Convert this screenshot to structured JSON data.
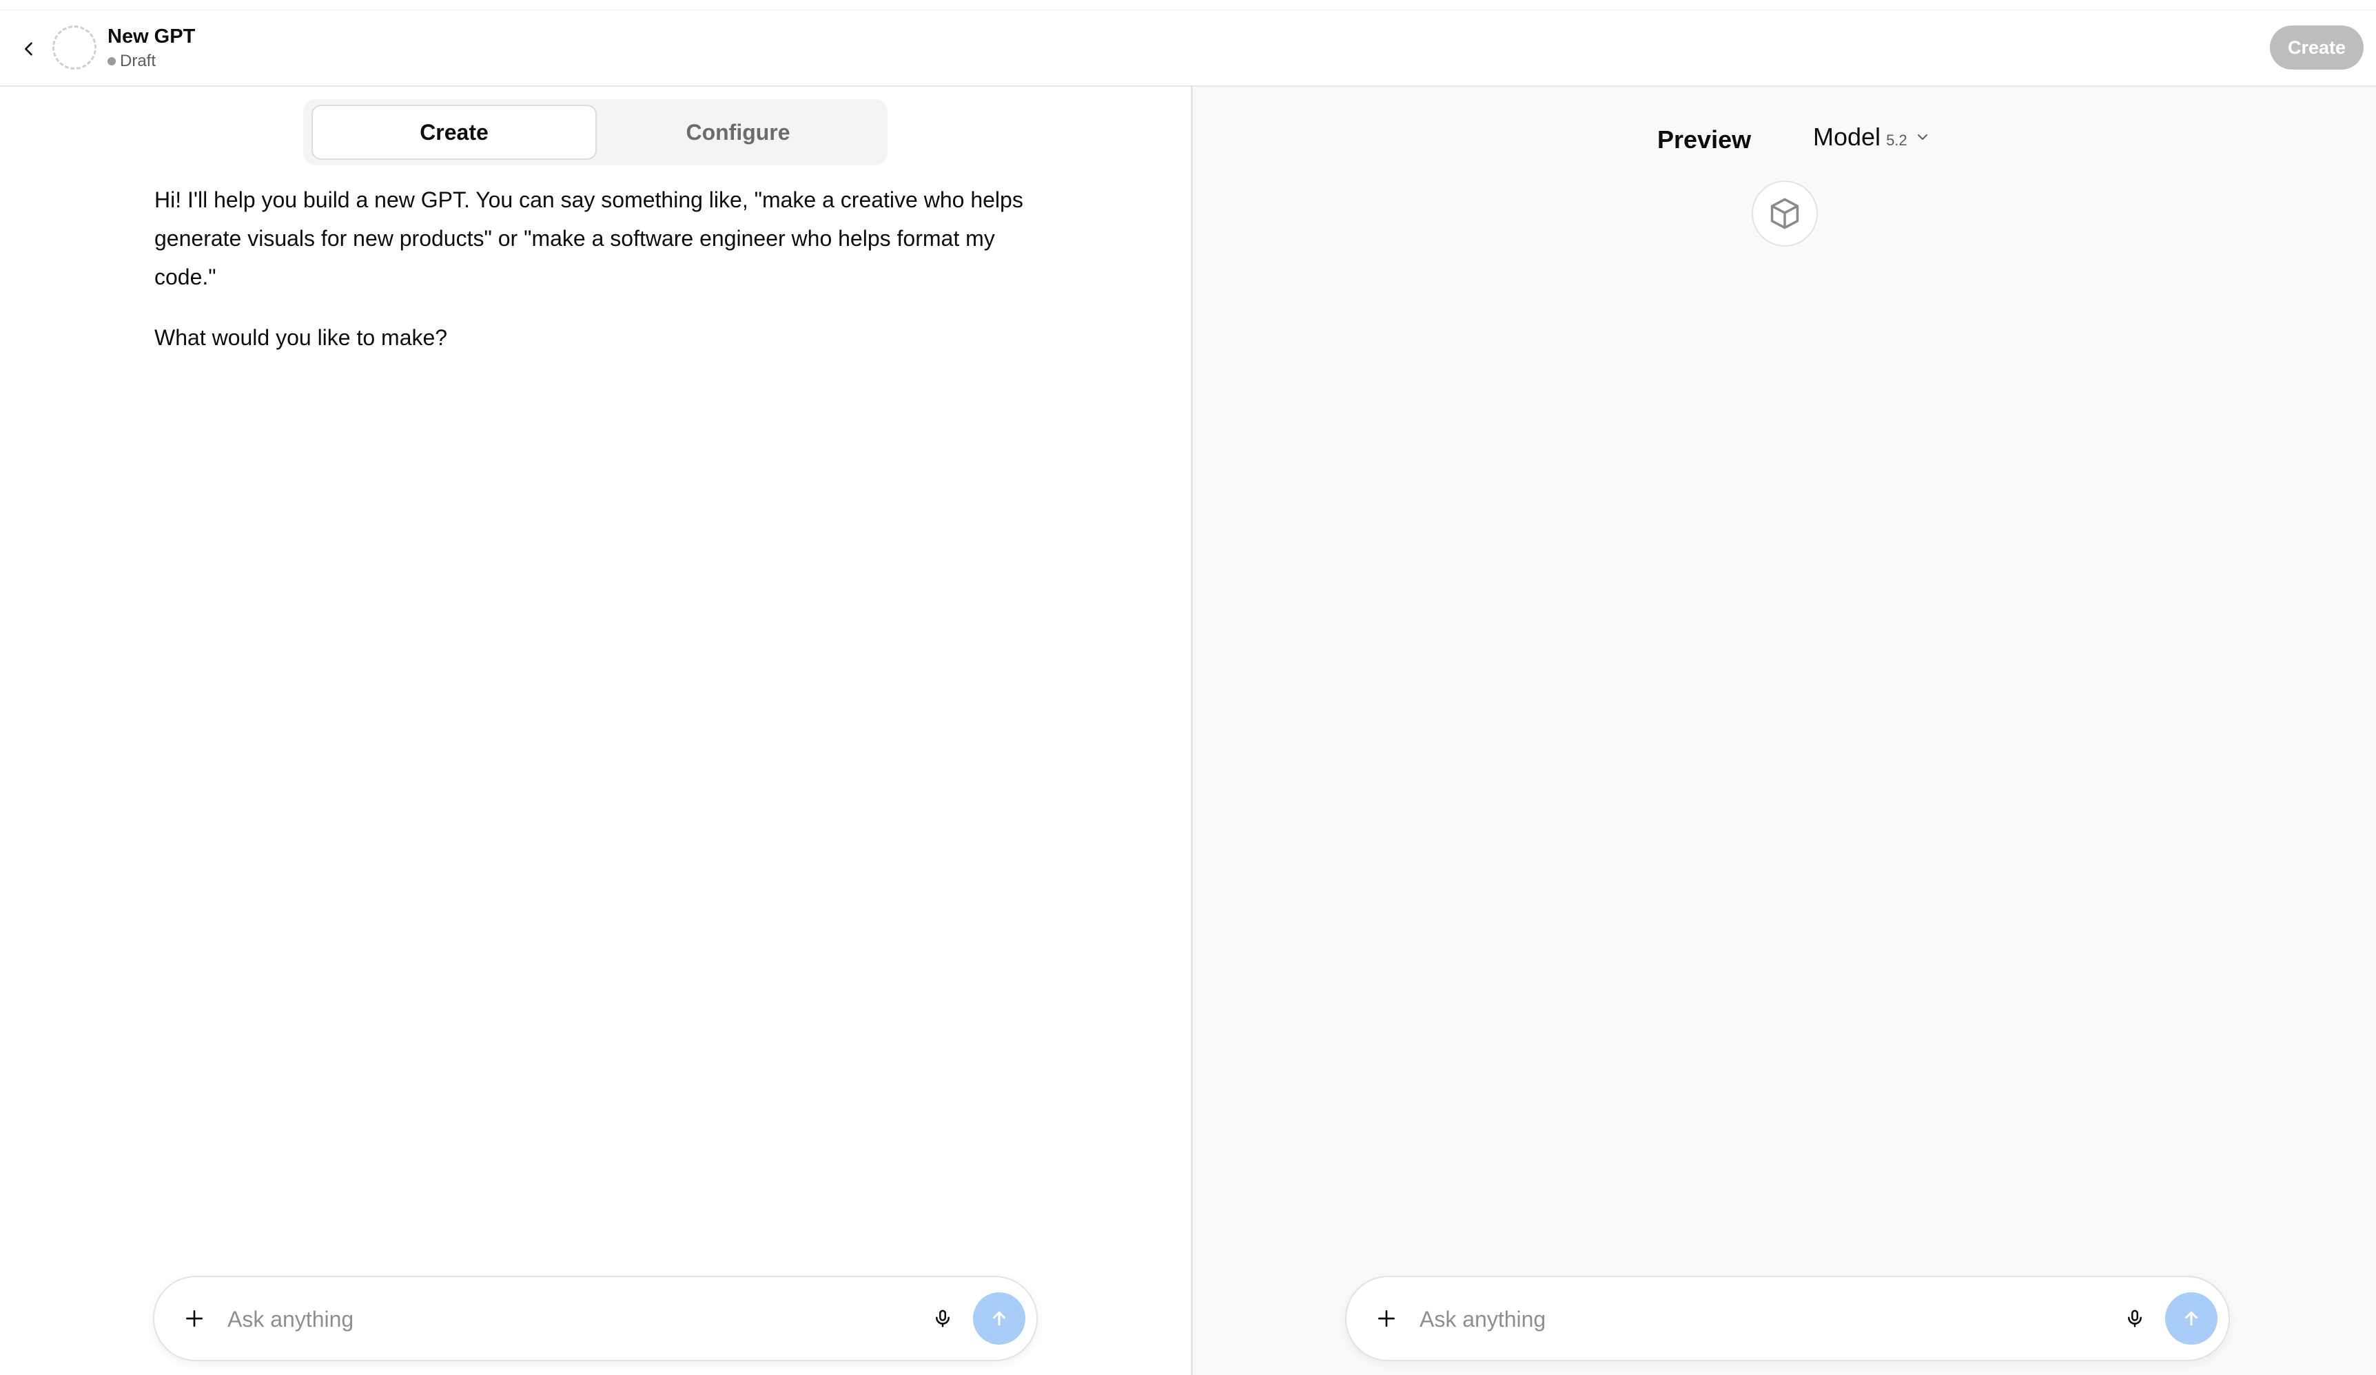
{
  "header": {
    "title": "New GPT",
    "status": "Draft",
    "create_label": "Create"
  },
  "tabs": [
    {
      "label": "Create",
      "active": true
    },
    {
      "label": "Configure",
      "active": false
    }
  ],
  "builder": {
    "messages": [
      "Hi! I'll help you build a new GPT. You can say something like, \"make a creative who helps generate visuals for new products\" or \"make a software engineer who helps format my code.\"",
      "What would you like to make?"
    ],
    "composer": {
      "placeholder": "Ask anything",
      "value": ""
    }
  },
  "preview": {
    "title": "Preview",
    "model_label": "Model",
    "model_version": "5.2",
    "composer": {
      "placeholder": "Ask anything",
      "value": ""
    }
  },
  "icons": {
    "back": "chevron-left-icon",
    "plus": "plus-icon",
    "mic": "microphone-icon",
    "send": "arrow-up-icon",
    "chevron": "chevron-down-icon",
    "avatar": "cube-icon"
  },
  "colors": {
    "send_button": "#a9cdf9",
    "create_button_disabled": "#bdbdbd",
    "preview_background": "#f9f9f9"
  }
}
